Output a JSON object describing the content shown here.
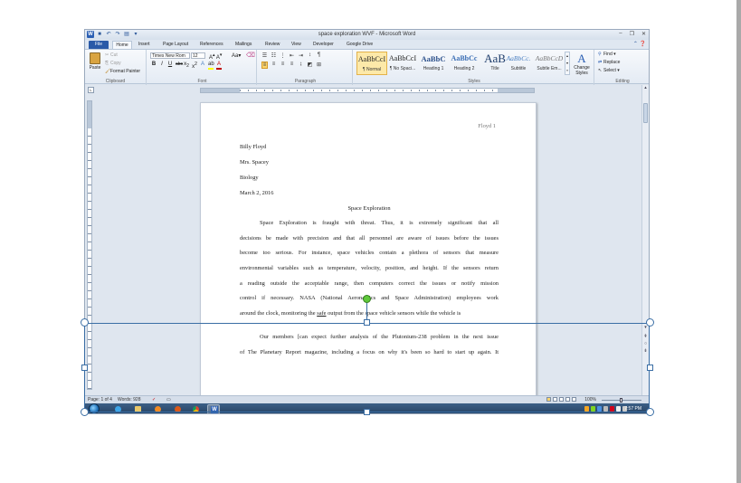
{
  "window": {
    "title": "space exploration WVF - Microsoft Word"
  },
  "tabs": [
    {
      "label": "File"
    },
    {
      "label": "Home"
    },
    {
      "label": "Insert"
    },
    {
      "label": "Page Layout"
    },
    {
      "label": "References"
    },
    {
      "label": "Mailings"
    },
    {
      "label": "Review"
    },
    {
      "label": "View"
    },
    {
      "label": "Developer"
    },
    {
      "label": "Google Drive"
    }
  ],
  "ribbon": {
    "clipboard": {
      "label": "Clipboard",
      "paste": "Paste",
      "cut": "Cut",
      "copy": "Copy",
      "format_painter": "Format Painter"
    },
    "font": {
      "label": "Font",
      "family": "Times New Rom",
      "size": "12"
    },
    "paragraph": {
      "label": "Paragraph"
    },
    "styles": {
      "label": "Styles",
      "items": [
        {
          "sample": "AaBbCcI",
          "name": "¶ Normal"
        },
        {
          "sample": "AaBbCcI",
          "name": "¶ No Spaci..."
        },
        {
          "sample": "AaBbC",
          "name": "Heading 1"
        },
        {
          "sample": "AaBbCc",
          "name": "Heading 2"
        },
        {
          "sample": "AaB",
          "name": "Title"
        },
        {
          "sample": "AaBbCc.",
          "name": "Subtitle"
        },
        {
          "sample": "AaBbCcD",
          "name": "Subtle Em..."
        }
      ],
      "change_styles": "Change Styles"
    },
    "editing": {
      "label": "Editing",
      "find": "Find",
      "replace": "Replace",
      "select": "Select"
    }
  },
  "document": {
    "header_right": "Floyd 1",
    "lines": {
      "name": "Billy Floyd",
      "teacher": "Mrs. Spacey",
      "subject": "Biology",
      "date": "March 2, 2016",
      "title": "Space Exploration",
      "p1_l1": "Space Exploration is fraught with threat. Thus, it is extremely significant that all",
      "p1_l2": "decisions be made with precision and that all personnel are aware of issues before the issues",
      "p1_l3": "become too serious.  For instance, space vehicles contain a plethora of sensors that measure",
      "p1_l4": "environmental variables  such as temperature, velocity, position, and height. If the sensors return",
      "p1_l5": "a reading outside the acceptable range, then computers correct the issues or notify mission",
      "p1_l6": "control if necessary.  NASA (National Aeronautics and Space Administration) employees  work",
      "p1_l7a": "around the clock, monitoring the ",
      "p1_l7u": "safe",
      "p1_l7b": " output from the space vehicle  sensors while the vehicle is",
      "p2_l1": "Our members  [can expect further analysis  of the Plutonium-238 problem in the next issue",
      "p2_l2": "of The Planetary Report magazine, including a focus on why it's been so hard to start up again.  It"
    }
  },
  "statusbar": {
    "page": "Page: 1 of 4",
    "words": "Words: 928",
    "zoom": "100%"
  },
  "taskbar": {
    "clock": "7:57 PM"
  }
}
